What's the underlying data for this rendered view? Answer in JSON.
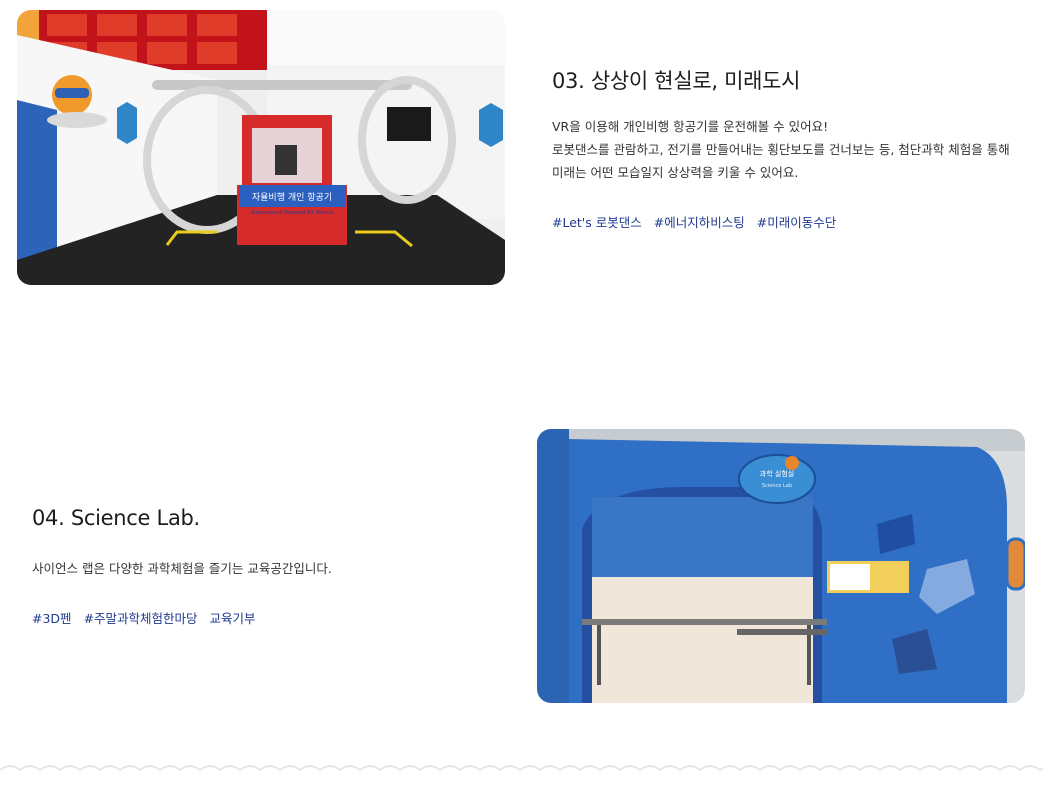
{
  "sections": [
    {
      "title": "03. 상상이 현실로, 미래도시",
      "description": [
        "VR을 이용해 개인비행 항공기를 운전해볼 수 있어요!",
        "로봇댄스를 관람하고, 전기를 만들어내는 횡단보도를 건너보는 등, 첨단과학 체험을 통해",
        "미래는 어떤 모습일지 상상력을 키울 수 있어요."
      ],
      "tags": [
        "#Let's 로봇댄스",
        "#에너지하비스팅",
        "#미래이동수단"
      ],
      "photo": {
        "sign_text": "자율비행 개인 항공기",
        "sign_subtext": "Autonomous Personal Air Vehicle"
      }
    },
    {
      "title": "04. Science Lab.",
      "description": [
        "사이언스 랩은 다양한 과학체험을 즐기는 교육공간입니다."
      ],
      "tags": [
        "#3D펜",
        "#주말과학체험한마당",
        "교육기부"
      ],
      "photo": {
        "sign_text": "과학 실험실",
        "sign_subtext": "Science Lab"
      }
    }
  ],
  "colors": {
    "tag": "#1f3b8f",
    "wave": "#e6e6e6"
  }
}
